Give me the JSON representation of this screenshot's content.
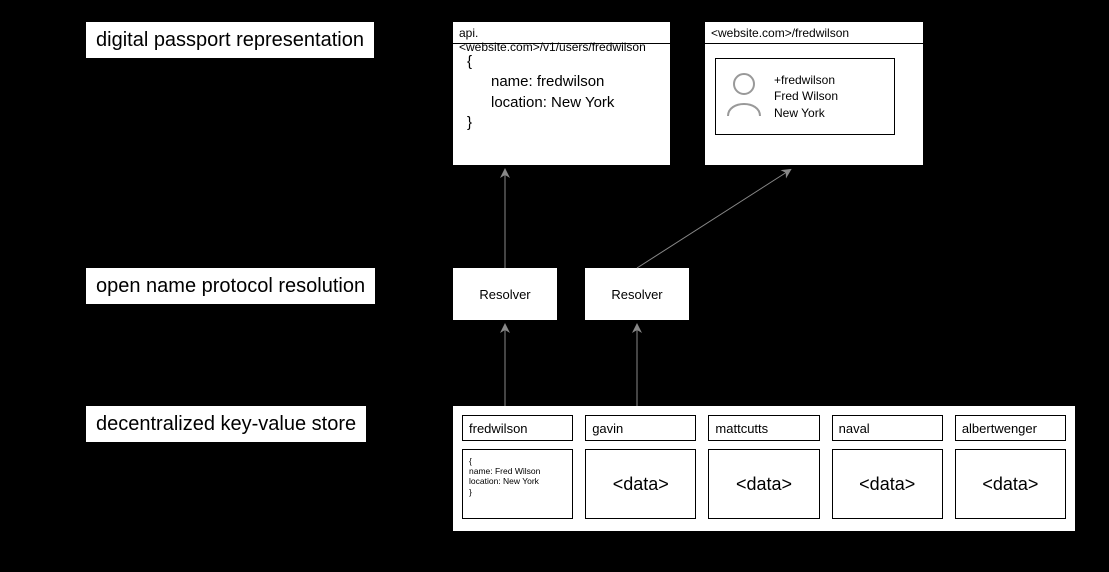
{
  "labels": {
    "top": "digital passport representation",
    "mid": "open name protocol resolution",
    "bot": "decentralized key-value store"
  },
  "api": {
    "url": "api.<website.com>/v1/users/fredwilson",
    "brace_open": "{",
    "line1": "name: fredwilson",
    "line2": "location: New York",
    "brace_close": "}"
  },
  "profile": {
    "url": "<website.com>/fredwilson",
    "line1": "+fredwilson",
    "line2": "Fred Wilson",
    "line3": "New York"
  },
  "resolvers": {
    "left": "Resolver",
    "right": "Resolver"
  },
  "store": [
    {
      "key": "fredwilson",
      "val": "{\nname: Fred Wilson\nlocation: New York\n}",
      "small": true
    },
    {
      "key": "gavin",
      "val": "<data>"
    },
    {
      "key": "mattcutts",
      "val": "<data>"
    },
    {
      "key": "naval",
      "val": "<data>"
    },
    {
      "key": "albertwenger",
      "val": "<data>"
    }
  ]
}
